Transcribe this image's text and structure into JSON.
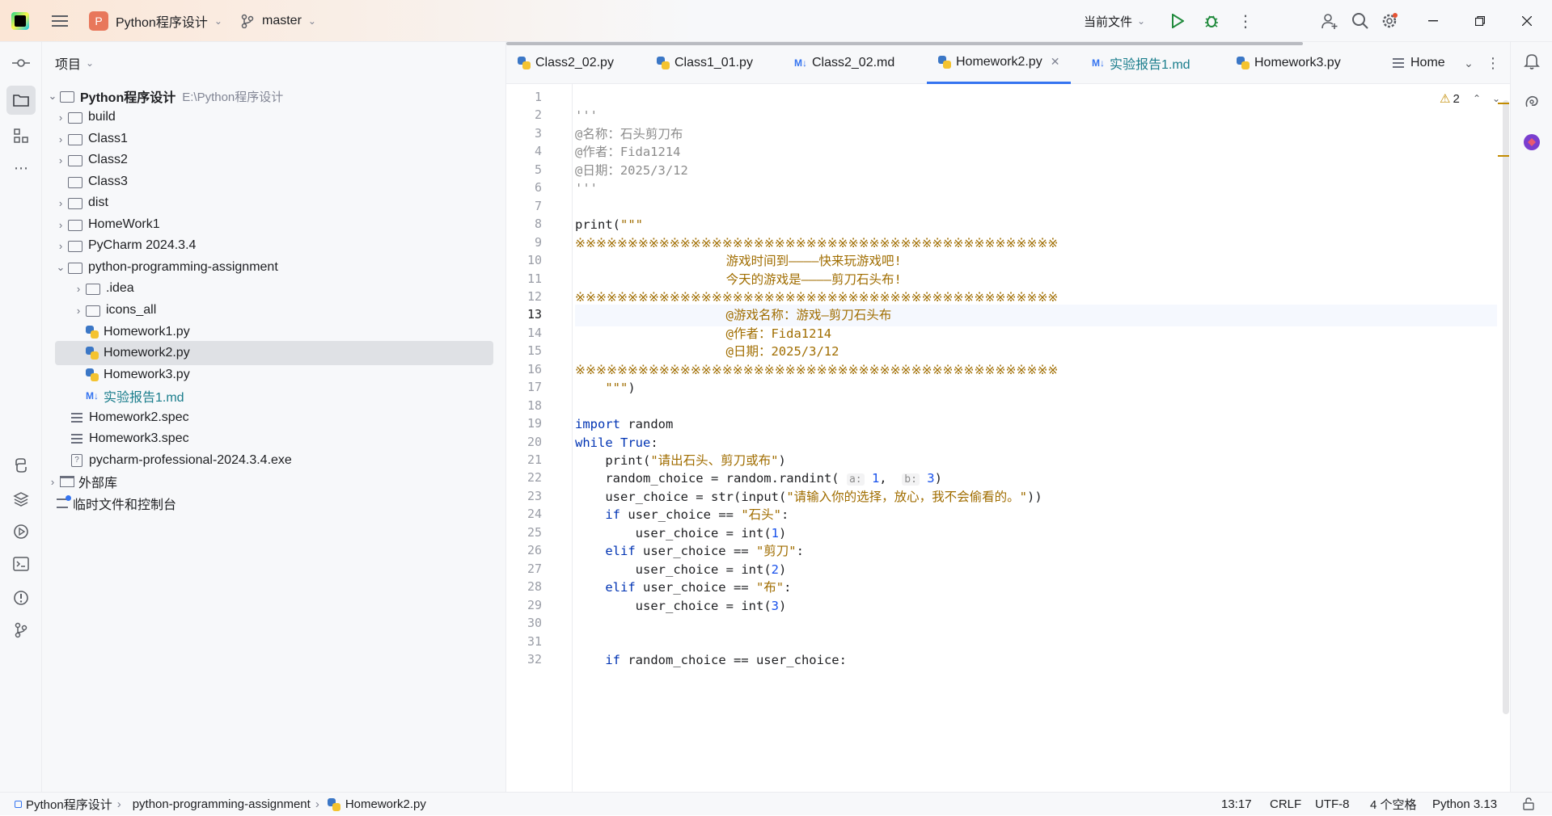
{
  "title_bar": {
    "project_badge": "P",
    "project_name": "Python程序设计",
    "branch": "master",
    "run_config": "当前文件",
    "window_controls": [
      "minimize-icon",
      "restore-icon",
      "close-icon"
    ]
  },
  "project_panel": {
    "header": "项目",
    "root": {
      "name": "Python程序设计",
      "path": "E:\\Python程序设计"
    },
    "items": [
      {
        "label": "build",
        "type": "folder",
        "expanded": false
      },
      {
        "label": "Class1",
        "type": "folder",
        "expanded": false
      },
      {
        "label": "Class2",
        "type": "folder",
        "expanded": false
      },
      {
        "label": "Class3",
        "type": "folder",
        "expanded": null
      },
      {
        "label": "dist",
        "type": "folder",
        "expanded": false
      },
      {
        "label": "HomeWork1",
        "type": "folder",
        "expanded": false
      },
      {
        "label": "PyCharm 2024.3.4",
        "type": "folder",
        "expanded": false
      },
      {
        "label": "python-programming-assignment",
        "type": "folder",
        "expanded": true
      },
      {
        "label": ".idea",
        "type": "folder",
        "expanded": false
      },
      {
        "label": "icons_all",
        "type": "folder",
        "expanded": false
      },
      {
        "label": "Homework1.py",
        "type": "python"
      },
      {
        "label": "Homework2.py",
        "type": "python",
        "selected": true
      },
      {
        "label": "Homework3.py",
        "type": "python"
      },
      {
        "label": "实验报告1.md",
        "type": "markdown"
      },
      {
        "label": "Homework2.spec",
        "type": "text"
      },
      {
        "label": "Homework3.spec",
        "type": "text"
      },
      {
        "label": "pycharm-professional-2024.3.4.exe",
        "type": "exe"
      }
    ],
    "external_libs": "外部库",
    "scratches": "临时文件和控制台"
  },
  "tabs": [
    {
      "label": "Class2_02.py",
      "type": "python"
    },
    {
      "label": "Class1_01.py",
      "type": "python"
    },
    {
      "label": "Class2_02.md",
      "type": "markdown"
    },
    {
      "label": "Homework2.py",
      "type": "python",
      "active": true
    },
    {
      "label": "实验报告1.md",
      "type": "markdown"
    },
    {
      "label": "Homework3.py",
      "type": "python"
    },
    {
      "label": "Home",
      "type": "text"
    }
  ],
  "editor": {
    "warning_count": "2",
    "current_line": 13,
    "line_numbers": [
      "1",
      "2",
      "3",
      "4",
      "5",
      "6",
      "7",
      "8",
      "9",
      "10",
      "11",
      "12",
      "13",
      "14",
      "15",
      "16",
      "17",
      "18",
      "19",
      "20",
      "21",
      "22",
      "23",
      "24",
      "25",
      "26",
      "27",
      "28",
      "29",
      "30",
      "31",
      "32"
    ],
    "lines": [
      "",
      "'''",
      "@名称：石头剪刀布",
      "@作者：Fida1214",
      "@日期：2025/3/12",
      "'''",
      "",
      "print(\"\"\"",
      "※※※※※※※※※※※※※※※※※※※※※※※※※※※※※※※※※※※※※※※※※※※※※※",
      "                    游戏时间到————快来玩游戏吧!",
      "                    今天的游戏是————剪刀石头布!",
      "※※※※※※※※※※※※※※※※※※※※※※※※※※※※※※※※※※※※※※※※※※※※※※",
      "                    @游戏名称：游戏—剪刀石头布",
      "                    @作者：Fida1214",
      "                    @日期：2025/3/12",
      "※※※※※※※※※※※※※※※※※※※※※※※※※※※※※※※※※※※※※※※※※※※※※※",
      "    \"\"\")",
      "",
      "import random",
      "while True:",
      "    print(\"请出石头、剪刀或布\")",
      "    random_choice = random.randint( a: 1,  b: 3)",
      "    user_choice = str(input(\"请输入你的选择，放心，我不会偷看的。\"))",
      "    if user_choice == \"石头\":",
      "        user_choice = int(1)",
      "    elif user_choice == \"剪刀\":",
      "        user_choice = int(2)",
      "    elif user_choice == \"布\":",
      "        user_choice = int(3)",
      "",
      "",
      "    if random_choice == user_choice:"
    ]
  },
  "status_bar": {
    "breadcrumb": [
      "Python程序设计",
      "python-programming-assignment",
      "Homework2.py"
    ],
    "position": "13:17",
    "line_sep": "CRLF",
    "encoding": "UTF-8",
    "indent": "4 个空格",
    "interpreter": "Python 3.13"
  }
}
